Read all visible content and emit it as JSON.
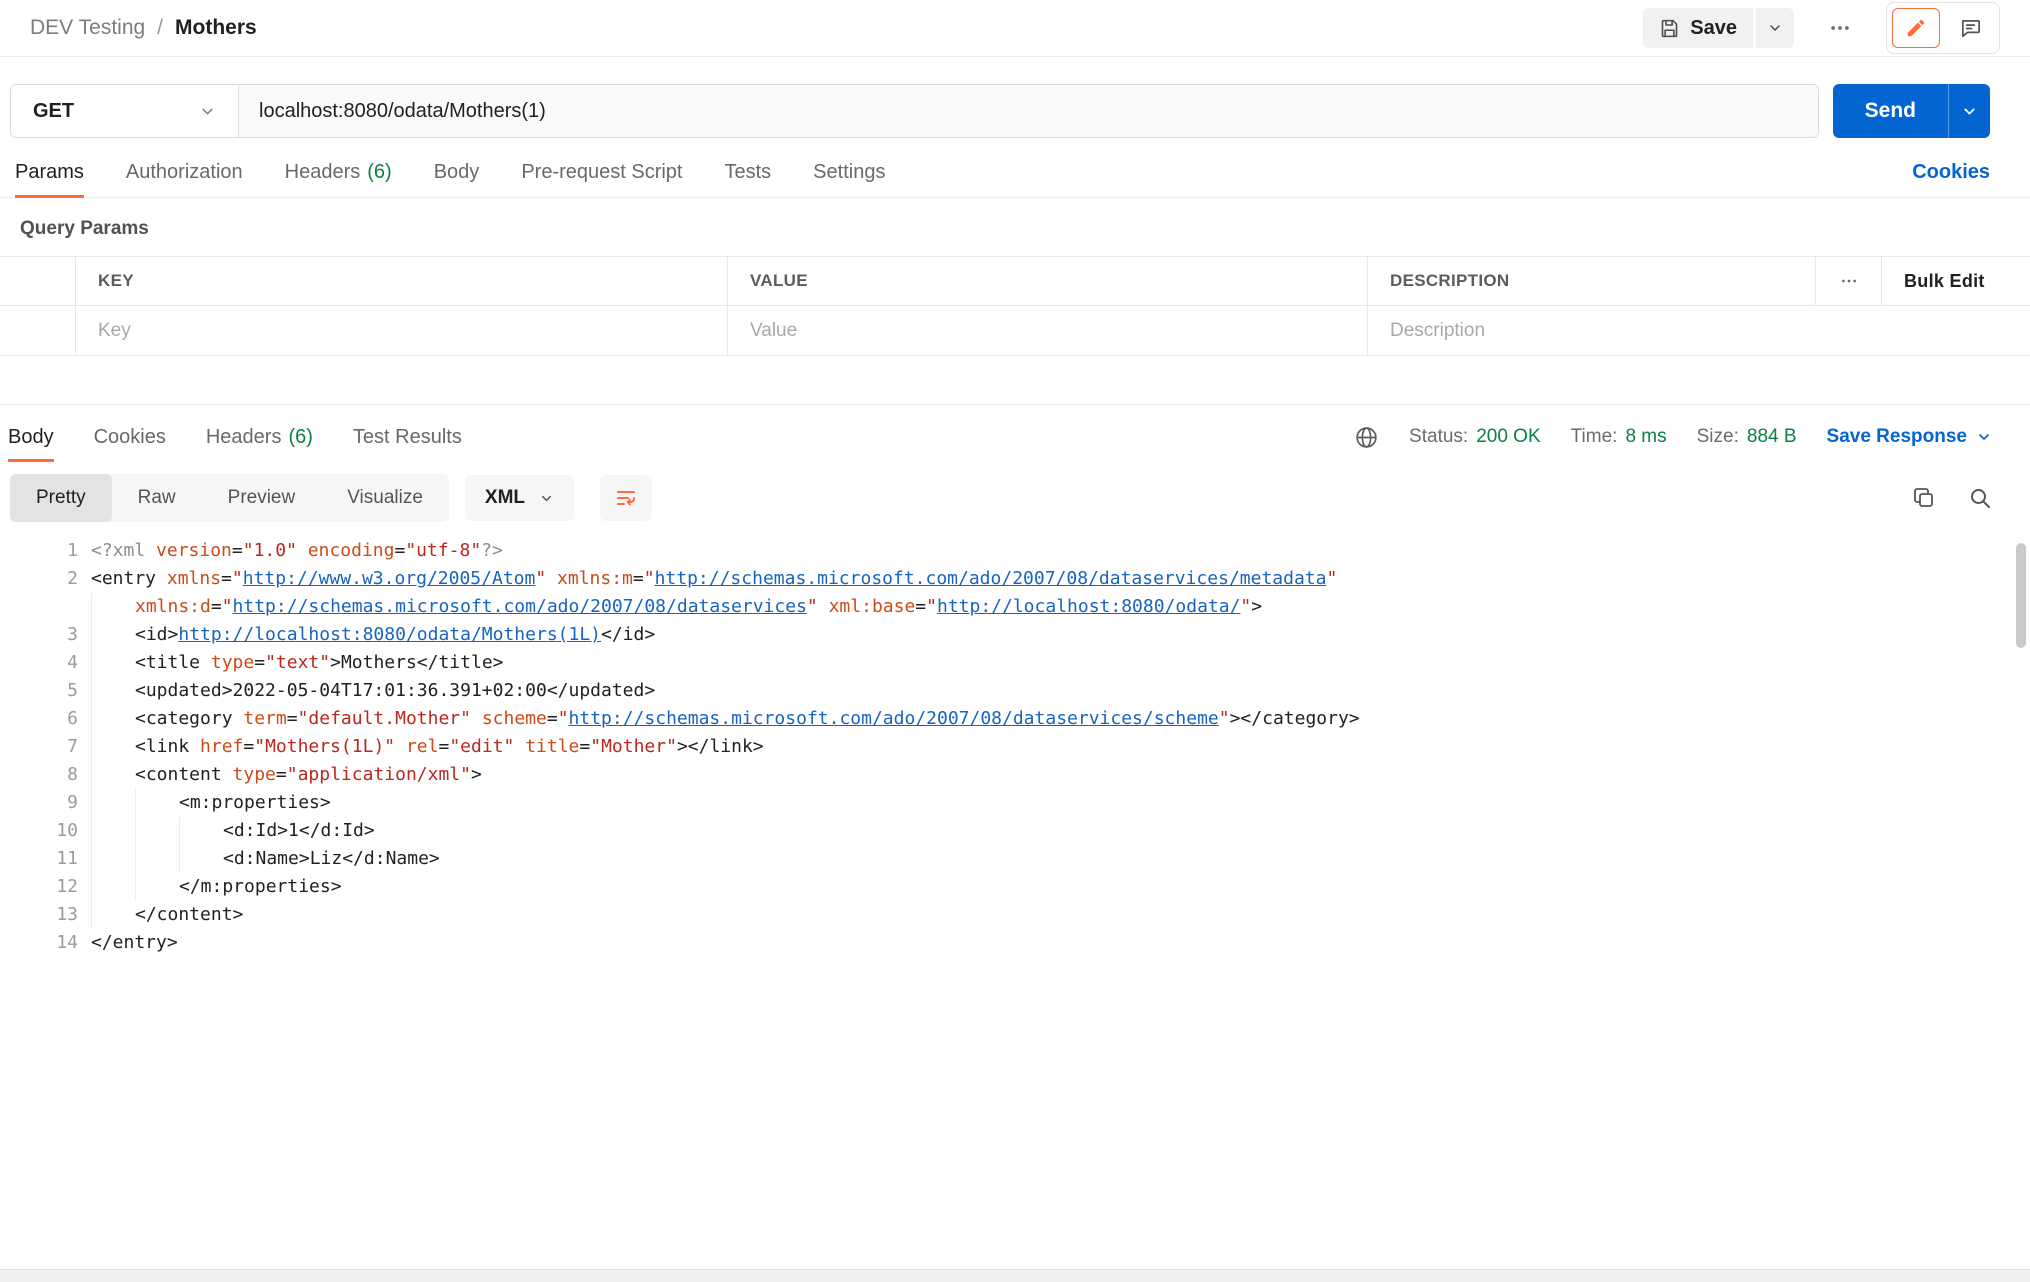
{
  "colors": {
    "accent_orange": "#FF6C37",
    "success_green": "#0B8043",
    "link_blue": "#0265D2",
    "send_blue": "#0265D2",
    "code_tag": "#212121",
    "code_attr": "#CD4A19",
    "code_string": "#B9271D",
    "code_link": "#1664C0",
    "code_meta": "#8C8C8C",
    "code_text": "#212121"
  },
  "icons": {
    "save": "floppy-disk",
    "save_more": "chevron-down",
    "more_actions": "three-dots",
    "edit": "pencil",
    "comments": "speech-bubble",
    "method_caret": "chevron-down",
    "send_caret": "chevron-down",
    "params_more": "three-dots",
    "network": "globe",
    "save_response_caret": "chevron-down",
    "format_caret": "chevron-down",
    "wrap_lines": "wrap-arrow",
    "copy": "copy",
    "search": "magnifier"
  },
  "topbar": {
    "breadcrumb": {
      "workspace": "DEV Testing",
      "separator": "/",
      "request_name": "Mothers"
    },
    "save_label": "Save"
  },
  "request_bar": {
    "method": "GET",
    "url": "localhost:8080/odata/Mothers(1)",
    "send_label": "Send"
  },
  "request_tabs": [
    {
      "label": "Params",
      "count": "",
      "active": true
    },
    {
      "label": "Authorization",
      "count": "",
      "active": false
    },
    {
      "label": "Headers",
      "count": "(6)",
      "active": false
    },
    {
      "label": "Body",
      "count": "",
      "active": false
    },
    {
      "label": "Pre-request Script",
      "count": "",
      "active": false
    },
    {
      "label": "Tests",
      "count": "",
      "active": false
    },
    {
      "label": "Settings",
      "count": "",
      "active": false
    }
  ],
  "cookies_link": "Cookies",
  "query_params": {
    "title": "Query Params",
    "columns": [
      "KEY",
      "VALUE",
      "DESCRIPTION"
    ],
    "bulk_edit_label": "Bulk Edit",
    "placeholders": {
      "key": "Key",
      "value": "Value",
      "description": "Description"
    }
  },
  "response": {
    "tabs": [
      {
        "label": "Body",
        "count": "",
        "active": true
      },
      {
        "label": "Cookies",
        "count": "",
        "active": false
      },
      {
        "label": "Headers",
        "count": "(6)",
        "active": false
      },
      {
        "label": "Test Results",
        "count": "",
        "active": false
      }
    ],
    "status_label": "Status:",
    "status_value": "200 OK",
    "time_label": "Time:",
    "time_value": "8 ms",
    "size_label": "Size:",
    "size_value": "884 B",
    "save_response_label": "Save Response",
    "view_tabs": [
      {
        "label": "Pretty",
        "active": true
      },
      {
        "label": "Raw",
        "active": false
      },
      {
        "label": "Preview",
        "active": false
      },
      {
        "label": "Visualize",
        "active": false
      }
    ],
    "format_selector": "XML"
  },
  "code": {
    "lines": [
      {
        "num": "1",
        "indent": 0,
        "tokens": [
          [
            "m",
            "<?xml "
          ],
          [
            "a",
            "version"
          ],
          [
            "o",
            "="
          ],
          [
            "s",
            "\"1.0\""
          ],
          [
            "o",
            " "
          ],
          [
            "a",
            "encoding"
          ],
          [
            "o",
            "="
          ],
          [
            "s",
            "\"utf-8\""
          ],
          [
            "m",
            "?>"
          ]
        ]
      },
      {
        "num": "2",
        "indent": 0,
        "tokens": [
          [
            "t",
            "<entry "
          ],
          [
            "a",
            "xmlns"
          ],
          [
            "o",
            "="
          ],
          [
            "s",
            "\""
          ],
          [
            "l",
            "http://www.w3.org/2005/Atom"
          ],
          [
            "s",
            "\""
          ],
          [
            "o",
            " "
          ],
          [
            "a",
            "xmlns:m"
          ],
          [
            "o",
            "="
          ],
          [
            "s",
            "\""
          ],
          [
            "l",
            "http://schemas.microsoft.com/ado/2007/08/dataservices/metadata"
          ],
          [
            "s",
            "\""
          ]
        ]
      },
      {
        "num": "",
        "indent": 1,
        "tokens": [
          [
            "a",
            "xmlns:d"
          ],
          [
            "o",
            "="
          ],
          [
            "s",
            "\""
          ],
          [
            "l",
            "http://schemas.microsoft.com/ado/2007/08/dataservices"
          ],
          [
            "s",
            "\""
          ],
          [
            "o",
            " "
          ],
          [
            "a",
            "xml:base"
          ],
          [
            "o",
            "="
          ],
          [
            "s",
            "\""
          ],
          [
            "l",
            "http://localhost:8080/odata/"
          ],
          [
            "s",
            "\""
          ],
          [
            "t",
            ">"
          ]
        ]
      },
      {
        "num": "3",
        "indent": 1,
        "tokens": [
          [
            "t",
            "<id>"
          ],
          [
            "l",
            "http://localhost:8080/odata/Mothers(1L)"
          ],
          [
            "t",
            "</id>"
          ]
        ]
      },
      {
        "num": "4",
        "indent": 1,
        "tokens": [
          [
            "t",
            "<title "
          ],
          [
            "a",
            "type"
          ],
          [
            "o",
            "="
          ],
          [
            "s",
            "\"text\""
          ],
          [
            "t",
            ">"
          ],
          [
            "x",
            "Mothers"
          ],
          [
            "t",
            "</title>"
          ]
        ]
      },
      {
        "num": "5",
        "indent": 1,
        "tokens": [
          [
            "t",
            "<updated>"
          ],
          [
            "x",
            "2022-05-04T17:01:36.391+02:00"
          ],
          [
            "t",
            "</updated>"
          ]
        ]
      },
      {
        "num": "6",
        "indent": 1,
        "tokens": [
          [
            "t",
            "<category "
          ],
          [
            "a",
            "term"
          ],
          [
            "o",
            "="
          ],
          [
            "s",
            "\"default.Mother\""
          ],
          [
            "o",
            " "
          ],
          [
            "a",
            "scheme"
          ],
          [
            "o",
            "="
          ],
          [
            "s",
            "\""
          ],
          [
            "l",
            "http://schemas.microsoft.com/ado/2007/08/dataservices/scheme"
          ],
          [
            "s",
            "\""
          ],
          [
            "t",
            "></category>"
          ]
        ]
      },
      {
        "num": "7",
        "indent": 1,
        "tokens": [
          [
            "t",
            "<link "
          ],
          [
            "a",
            "href"
          ],
          [
            "o",
            "="
          ],
          [
            "s",
            "\"Mothers(1L)\""
          ],
          [
            "o",
            " "
          ],
          [
            "a",
            "rel"
          ],
          [
            "o",
            "="
          ],
          [
            "s",
            "\"edit\""
          ],
          [
            "o",
            " "
          ],
          [
            "a",
            "title"
          ],
          [
            "o",
            "="
          ],
          [
            "s",
            "\"Mother\""
          ],
          [
            "t",
            "></link>"
          ]
        ]
      },
      {
        "num": "8",
        "indent": 1,
        "tokens": [
          [
            "t",
            "<content "
          ],
          [
            "a",
            "type"
          ],
          [
            "o",
            "="
          ],
          [
            "s",
            "\"application/xml\""
          ],
          [
            "t",
            ">"
          ]
        ]
      },
      {
        "num": "9",
        "indent": 2,
        "tokens": [
          [
            "t",
            "<m:properties>"
          ]
        ]
      },
      {
        "num": "10",
        "indent": 3,
        "tokens": [
          [
            "t",
            "<d:Id>"
          ],
          [
            "x",
            "1"
          ],
          [
            "t",
            "</d:Id>"
          ]
        ]
      },
      {
        "num": "11",
        "indent": 3,
        "tokens": [
          [
            "t",
            "<d:Name>"
          ],
          [
            "x",
            "Liz"
          ],
          [
            "t",
            "</d:Name>"
          ]
        ]
      },
      {
        "num": "12",
        "indent": 2,
        "tokens": [
          [
            "t",
            "</m:properties>"
          ]
        ]
      },
      {
        "num": "13",
        "indent": 1,
        "tokens": [
          [
            "t",
            "</content>"
          ]
        ]
      },
      {
        "num": "14",
        "indent": 0,
        "tokens": [
          [
            "t",
            "</entry>"
          ]
        ]
      }
    ]
  }
}
